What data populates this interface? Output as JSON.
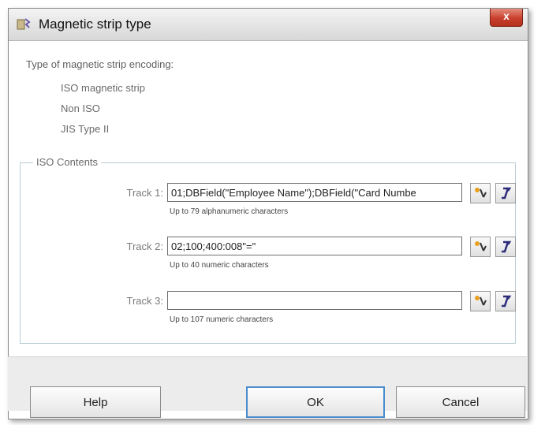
{
  "window": {
    "title": "Magnetic strip type",
    "close_glyph": "x"
  },
  "encoding": {
    "label": "Type of magnetic strip encoding:",
    "options": [
      {
        "label": "ISO magnetic strip"
      },
      {
        "label": "Non ISO"
      },
      {
        "label": "JIS Type II"
      }
    ]
  },
  "iso_contents": {
    "legend": "ISO Contents",
    "tracks": [
      {
        "label": "Track 1:",
        "value": "01;DBField(\"Employee Name\");DBField(\"Card Numbe",
        "hint": "Up to 79 alphanumeric characters"
      },
      {
        "label": "Track 2:",
        "value": "02;100;400:008\"=\"",
        "hint": "Up to 40 numeric characters"
      },
      {
        "label": "Track 3:",
        "value": "",
        "hint": "Up to 107 numeric characters"
      }
    ]
  },
  "buttons": {
    "help": "Help",
    "ok": "OK",
    "cancel": "Cancel"
  },
  "icons": {
    "app": "magnetic-card-icon",
    "insert_field": "insert-field-icon",
    "formula": "formula-icon"
  }
}
